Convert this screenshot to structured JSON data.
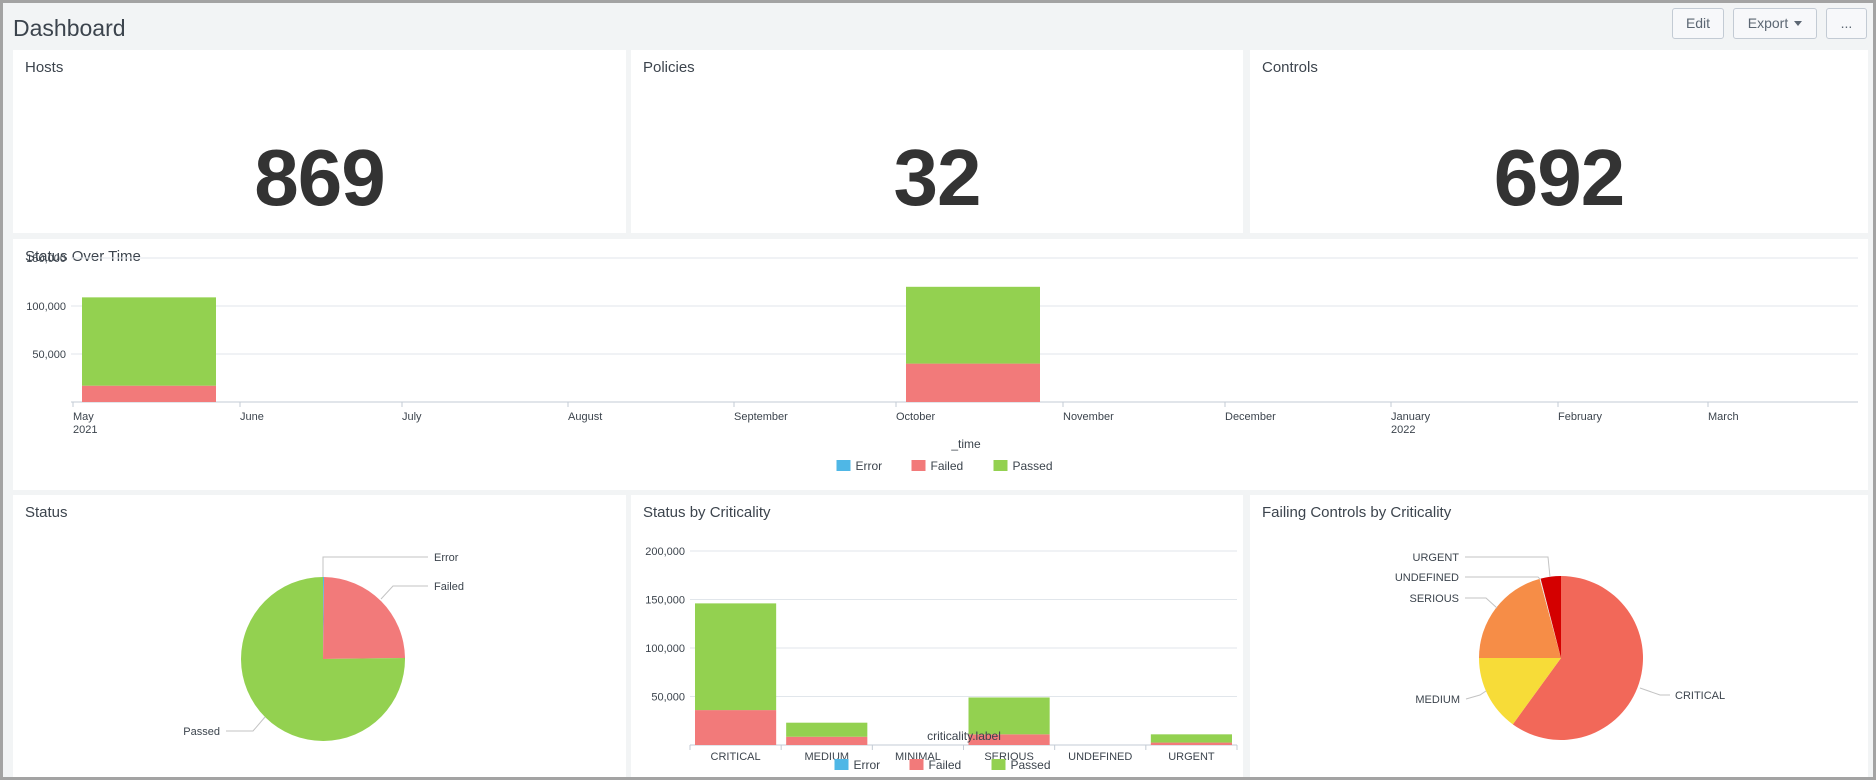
{
  "header": {
    "title": "Dashboard",
    "buttons": {
      "edit": "Edit",
      "export": "Export",
      "more": "..."
    }
  },
  "single_values": [
    {
      "title": "Hosts",
      "value": "869"
    },
    {
      "title": "Policies",
      "value": "32"
    },
    {
      "title": "Controls",
      "value": "692"
    }
  ],
  "colors": {
    "error": "#4fb7e6",
    "failed": "#f27a7a",
    "passed": "#93d150",
    "critical": "#f26859",
    "medium": "#f7dc38",
    "serious": "#f68d47",
    "undefined": "#e8e8e8",
    "urgent": "#d40000"
  },
  "chart_data": [
    {
      "id": "status_over_time",
      "type": "bar",
      "stacked": true,
      "title": "Status Over Time",
      "xlabel": "_time",
      "ylabel": "",
      "ylim": [
        0,
        150000
      ],
      "yticks": [
        "50,000",
        "100,000",
        "150,000"
      ],
      "ytick_values": [
        50000,
        100000,
        150000
      ],
      "x_ticks": [
        {
          "label": "May",
          "sub": "2021"
        },
        {
          "label": "June",
          "sub": ""
        },
        {
          "label": "July",
          "sub": ""
        },
        {
          "label": "August",
          "sub": ""
        },
        {
          "label": "September",
          "sub": ""
        },
        {
          "label": "October",
          "sub": ""
        },
        {
          "label": "November",
          "sub": ""
        },
        {
          "label": "December",
          "sub": ""
        },
        {
          "label": "January",
          "sub": "2022"
        },
        {
          "label": "February",
          "sub": ""
        },
        {
          "label": "March",
          "sub": ""
        }
      ],
      "categories": [
        "May 2021",
        "October 2021"
      ],
      "series": [
        {
          "name": "Error",
          "values": [
            0,
            0
          ]
        },
        {
          "name": "Failed",
          "values": [
            17000,
            40000
          ]
        },
        {
          "name": "Passed",
          "values": [
            92000,
            80000
          ]
        }
      ],
      "grid": true,
      "legend": "bottom"
    },
    {
      "id": "status",
      "type": "pie",
      "title": "Status",
      "labels": [
        "Error",
        "Failed",
        "Passed"
      ],
      "values": [
        0.2,
        24.6,
        75.2
      ],
      "legend": "labels"
    },
    {
      "id": "status_by_criticality",
      "type": "bar",
      "stacked": true,
      "title": "Status by Criticality",
      "xlabel": "criticality.label",
      "ylabel": "",
      "ylim": [
        0,
        200000
      ],
      "yticks": [
        "50,000",
        "100,000",
        "150,000",
        "200,000"
      ],
      "ytick_values": [
        50000,
        100000,
        150000,
        200000
      ],
      "categories": [
        "CRITICAL",
        "MEDIUM",
        "MINIMAL",
        "SERIOUS",
        "UNDEFINED",
        "URGENT"
      ],
      "series": [
        {
          "name": "Error",
          "values": [
            0,
            0,
            0,
            0,
            0,
            0
          ]
        },
        {
          "name": "Failed",
          "values": [
            36000,
            8500,
            0,
            11000,
            0,
            2500
          ]
        },
        {
          "name": "Passed",
          "values": [
            110000,
            14500,
            0,
            38000,
            0,
            8500
          ]
        }
      ],
      "grid": true,
      "legend": "bottom"
    },
    {
      "id": "failing_controls_by_criticality",
      "type": "pie",
      "title": "Failing Controls by Criticality",
      "labels": [
        "CRITICAL",
        "MEDIUM",
        "SERIOUS",
        "UNDEFINED",
        "URGENT"
      ],
      "values": [
        60,
        15,
        20.8,
        0.2,
        4
      ],
      "legend": "labels"
    }
  ]
}
